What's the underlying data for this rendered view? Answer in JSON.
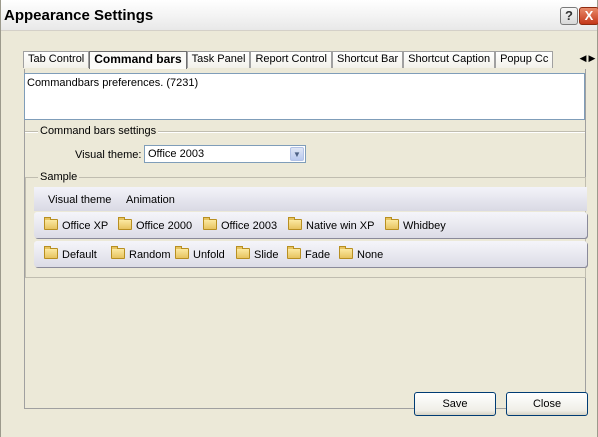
{
  "window": {
    "title": "Appearance Settings",
    "help_glyph": "?",
    "close_glyph": "X"
  },
  "tabs": [
    {
      "label": "Tab Control",
      "active": false
    },
    {
      "label": "Command bars",
      "active": true
    },
    {
      "label": "Task Panel",
      "active": false
    },
    {
      "label": "Report Control",
      "active": false
    },
    {
      "label": "Shortcut Bar",
      "active": false
    },
    {
      "label": "Shortcut Caption",
      "active": false
    },
    {
      "label": "Popup Cc",
      "active": false
    }
  ],
  "tab_scroll": {
    "left_glyph": "◀",
    "right_glyph": "▶"
  },
  "description": "Commandbars preferences. (7231)",
  "command_bars_settings": {
    "group_title": "Command bars settings",
    "visual_theme_label": "Visual theme:",
    "visual_theme_value": "Office 2003"
  },
  "sample": {
    "group_title": "Sample",
    "header_items": [
      "Visual theme",
      "Animation"
    ],
    "theme_bar": [
      "Office XP",
      "Office 2000",
      "Office 2003",
      "Native win XP",
      "Whidbey"
    ],
    "animation_bar": [
      "Default",
      "Random",
      "Unfold",
      "Slide",
      "Fade",
      "None"
    ]
  },
  "buttons": {
    "save": "Save",
    "close": "Close"
  },
  "icons": {
    "folder": "folder-icon",
    "dropdown": "chevron-down-icon",
    "help": "help-icon",
    "close": "close-icon"
  }
}
